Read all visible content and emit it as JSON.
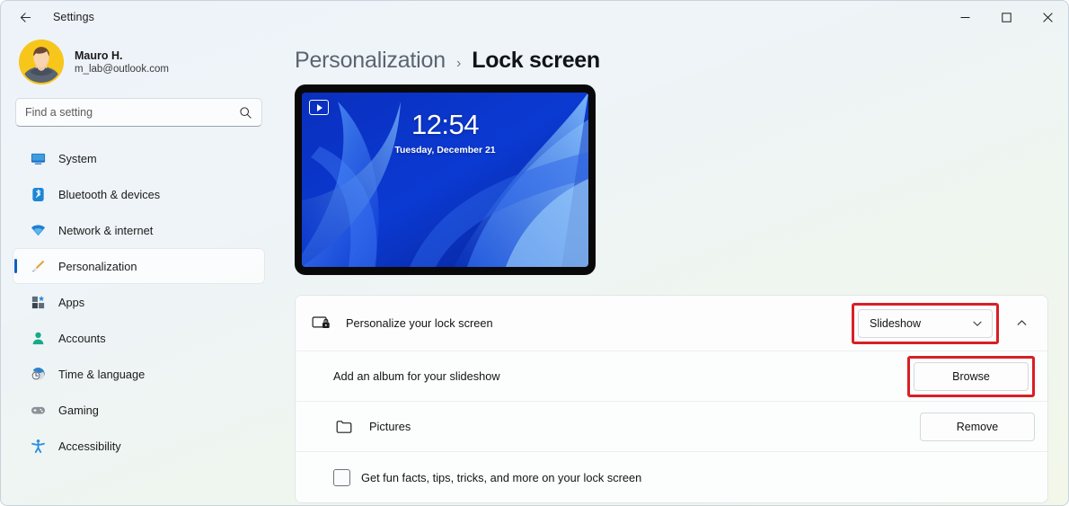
{
  "window": {
    "title": "Settings",
    "back_label": "back-arrow",
    "controls": {
      "minimize": "—",
      "maximize": "▢",
      "close": "✕"
    }
  },
  "account": {
    "name": "Mauro H.",
    "email": "m_lab@outlook.com"
  },
  "search": {
    "placeholder": "Find a setting",
    "value": ""
  },
  "sidebar": {
    "items": [
      {
        "label": "System",
        "icon": "monitor-icon",
        "selected": false
      },
      {
        "label": "Bluetooth & devices",
        "icon": "bluetooth-icon",
        "selected": false
      },
      {
        "label": "Network & internet",
        "icon": "wifi-icon",
        "selected": false
      },
      {
        "label": "Personalization",
        "icon": "paintbrush-icon",
        "selected": true
      },
      {
        "label": "Apps",
        "icon": "apps-icon",
        "selected": false
      },
      {
        "label": "Accounts",
        "icon": "person-icon",
        "selected": false
      },
      {
        "label": "Time & language",
        "icon": "clock-globe-icon",
        "selected": false
      },
      {
        "label": "Gaming",
        "icon": "gamepad-icon",
        "selected": false
      },
      {
        "label": "Accessibility",
        "icon": "accessibility-icon",
        "selected": false
      }
    ]
  },
  "breadcrumb": {
    "parent": "Personalization",
    "separator": "›",
    "current": "Lock screen"
  },
  "preview": {
    "time": "12:54",
    "date": "Tuesday, December 21",
    "badge_icon": "slideshow-play-icon"
  },
  "settings": {
    "personalize_row": {
      "label": "Personalize your lock screen",
      "icon": "lock-screen-icon",
      "dropdown_value": "Slideshow",
      "dropdown_chevron": "chevron-down-icon",
      "expand_chevron": "chevron-up-icon",
      "highlighted": true
    },
    "album_row": {
      "label": "Add an album for your slideshow",
      "button_label": "Browse",
      "highlighted": true
    },
    "folder_row": {
      "label": "Pictures",
      "icon": "folder-icon",
      "button_label": "Remove"
    },
    "funfacts_row": {
      "label": "Get fun facts, tips, tricks, and more on your lock screen",
      "checked": false
    }
  },
  "colors": {
    "accent": "#0f5fc2",
    "highlight": "#d81f26",
    "avatar_bg": "#f5c518"
  }
}
